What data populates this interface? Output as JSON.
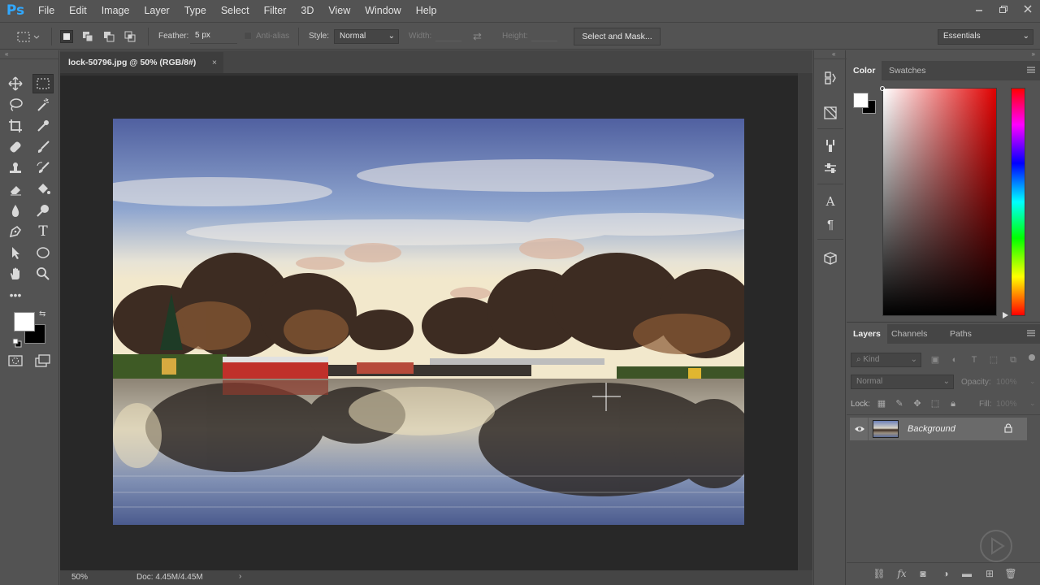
{
  "app": {
    "logo": "Ps"
  },
  "menu": [
    "File",
    "Edit",
    "Image",
    "Layer",
    "Type",
    "Select",
    "Filter",
    "3D",
    "View",
    "Window",
    "Help"
  ],
  "options": {
    "feather_label": "Feather:",
    "feather_value": "5 px",
    "antialias_label": "Anti-alias",
    "style_label": "Style:",
    "style_value": "Normal",
    "width_label": "Width:",
    "height_label": "Height:",
    "select_mask_button": "Select and Mask...",
    "workspace": "Essentials"
  },
  "document": {
    "tab_title": "lock-50796.jpg @ 50% (RGB/8#)",
    "zoom": "50%",
    "doc_size": "Doc: 4.45M/4.45M"
  },
  "color_panel": {
    "tabs": [
      "Color",
      "Swatches"
    ],
    "foreground": "#ffffff",
    "background": "#000000"
  },
  "layers_panel": {
    "tabs": [
      "Layers",
      "Channels",
      "Paths"
    ],
    "kind_placeholder": "Kind",
    "blend_mode": "Normal",
    "opacity_label": "Opacity:",
    "opacity_value": "100%",
    "lock_label": "Lock:",
    "fill_label": "Fill:",
    "fill_value": "100%",
    "layers": [
      {
        "name": "Background",
        "visible": true,
        "locked": true
      }
    ]
  },
  "colors": {
    "ui_bg": "#535353",
    "canvas_bg": "#282828",
    "accent": "#31a8ff"
  }
}
